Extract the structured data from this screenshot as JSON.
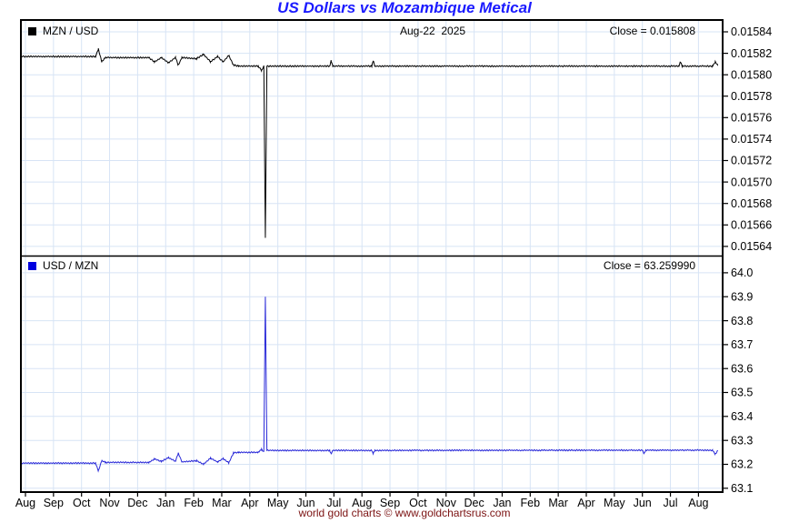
{
  "title": "US Dollars vs Mozambique Metical",
  "header": {
    "date_label": "Aug-22  2025"
  },
  "panels": [
    {
      "id": "mzn-usd",
      "legend_label": "MZN / USD",
      "close_label": "Close = 0.015808"
    },
    {
      "id": "usd-mzn",
      "legend_label": "USD / MZN",
      "close_label": "Close = 63.259990"
    }
  ],
  "footer": {
    "credit": "world gold charts © www.goldchartsrus.com"
  },
  "colors": {
    "title": "#1a1aff",
    "grid": "#d7e4f5",
    "frame": "#000000",
    "axis_text": "#000000",
    "footer": "#7b1212",
    "line_top": "#000000",
    "line_bottom": "#2828d8",
    "swatch_top": "#000000",
    "swatch_bottom": "#0000e0"
  },
  "x_axis": {
    "tick_labels": [
      "Aug",
      "Sep",
      "Oct",
      "Nov",
      "Dec",
      "Jan",
      "Feb",
      "Mar",
      "Apr",
      "May",
      "Jun",
      "Jul",
      "Aug",
      "Sep",
      "Oct",
      "Nov",
      "Dec",
      "Jan",
      "Feb",
      "Mar",
      "Apr",
      "May",
      "Jun",
      "Jul",
      "Aug"
    ],
    "start": "Aug 2023",
    "end": "Aug-22 2025",
    "x_unit": "months since Aug 2023"
  },
  "chart_data": [
    {
      "type": "line",
      "name": "MZN / USD",
      "legend_position": "top-left",
      "grid": true,
      "close": 0.015808,
      "ylim": [
        0.015631,
        0.015851
      ],
      "y_tick_labels": [
        "0.01584",
        "0.01582",
        "0.01580",
        "0.01578",
        "0.01576",
        "0.01574",
        "0.01572",
        "0.01570",
        "0.01568",
        "0.01566",
        "0.01564"
      ],
      "x_range": [
        -0.16,
        24.68
      ],
      "spike": {
        "x": 8.555,
        "low": 0.015648,
        "date_area": "late Apr 2024"
      },
      "anchors": [
        [
          -0.16,
          0.015817
        ],
        [
          2.5,
          0.015817
        ],
        [
          2.6,
          0.015824
        ],
        [
          2.72,
          0.015812
        ],
        [
          2.85,
          0.015816
        ],
        [
          4.4,
          0.015816
        ],
        [
          4.6,
          0.015812
        ],
        [
          4.85,
          0.015816
        ],
        [
          5.1,
          0.015811
        ],
        [
          5.35,
          0.015816
        ],
        [
          5.45,
          0.015809
        ],
        [
          5.58,
          0.015816
        ],
        [
          6.1,
          0.015815
        ],
        [
          6.35,
          0.015819
        ],
        [
          6.6,
          0.015812
        ],
        [
          6.85,
          0.015817
        ],
        [
          7.05,
          0.015812
        ],
        [
          7.25,
          0.015818
        ],
        [
          7.42,
          0.015809
        ],
        [
          7.6,
          0.015808
        ],
        [
          8.3,
          0.015808
        ],
        [
          8.42,
          0.015804
        ],
        [
          8.5,
          0.015808
        ],
        [
          8.555,
          0.015648
        ],
        [
          8.61,
          0.015808
        ],
        [
          10.85,
          0.015808
        ],
        [
          10.9,
          0.015813
        ],
        [
          10.96,
          0.015808
        ],
        [
          12.35,
          0.015808
        ],
        [
          12.4,
          0.015813
        ],
        [
          12.46,
          0.015808
        ],
        [
          23.3,
          0.015808
        ],
        [
          23.36,
          0.015812
        ],
        [
          23.42,
          0.015808
        ],
        [
          24.5,
          0.015808
        ],
        [
          24.6,
          0.015812
        ],
        [
          24.68,
          0.015809
        ]
      ],
      "noise_amplitude": 7e-07,
      "seed": 1234
    },
    {
      "type": "line",
      "name": "USD / MZN",
      "legend_position": "top-left",
      "grid": true,
      "close": 63.25999,
      "ylim": [
        63.084,
        64.07
      ],
      "y_tick_labels": [
        "64.0",
        "63.9",
        "63.8",
        "63.7",
        "63.6",
        "63.5",
        "63.4",
        "63.3",
        "63.2",
        "63.1"
      ],
      "x_range": [
        -0.16,
        24.68
      ],
      "spike": {
        "x": 8.555,
        "high": 63.9,
        "date_area": "late Apr 2024"
      },
      "anchors": [
        [
          -0.16,
          63.205
        ],
        [
          2.5,
          63.205
        ],
        [
          2.6,
          63.172
        ],
        [
          2.72,
          63.215
        ],
        [
          2.85,
          63.208
        ],
        [
          4.4,
          63.208
        ],
        [
          4.6,
          63.222
        ],
        [
          4.85,
          63.212
        ],
        [
          5.1,
          63.228
        ],
        [
          5.35,
          63.212
        ],
        [
          5.45,
          63.247
        ],
        [
          5.58,
          63.21
        ],
        [
          6.1,
          63.215
        ],
        [
          6.35,
          63.2
        ],
        [
          6.6,
          63.226
        ],
        [
          6.85,
          63.21
        ],
        [
          7.05,
          63.224
        ],
        [
          7.25,
          63.206
        ],
        [
          7.42,
          63.248
        ],
        [
          7.6,
          63.25
        ],
        [
          8.3,
          63.25
        ],
        [
          8.42,
          63.262
        ],
        [
          8.5,
          63.252
        ],
        [
          8.555,
          63.9
        ],
        [
          8.61,
          63.258
        ],
        [
          10.85,
          63.258
        ],
        [
          10.9,
          63.243
        ],
        [
          10.96,
          63.258
        ],
        [
          12.35,
          63.258
        ],
        [
          12.4,
          63.245
        ],
        [
          12.46,
          63.258
        ],
        [
          22.0,
          63.259
        ],
        [
          22.06,
          63.245
        ],
        [
          22.12,
          63.259
        ],
        [
          24.5,
          63.259
        ],
        [
          24.6,
          63.242
        ],
        [
          24.68,
          63.257
        ]
      ],
      "noise_amplitude": 0.003,
      "seed": 5678
    }
  ]
}
